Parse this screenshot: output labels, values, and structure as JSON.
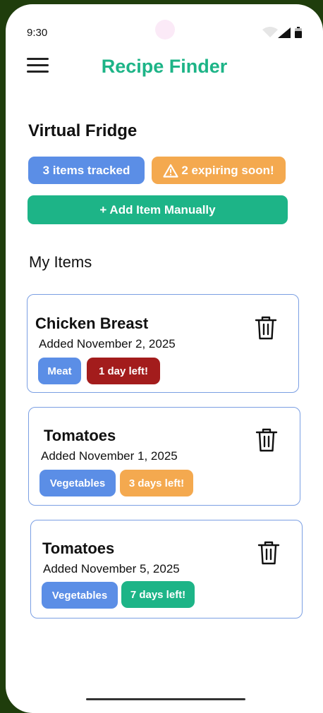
{
  "status_bar": {
    "time": "9:30"
  },
  "header": {
    "title": "Recipe Finder",
    "menu_icon": "hamburger-menu-icon"
  },
  "fridge": {
    "title": "Virtual Fridge",
    "tracked_badge": "3 items tracked",
    "expiring_badge": "2 expiring soon!",
    "add_button": "+ Add Item Manually"
  },
  "items_section": {
    "title": "My Items"
  },
  "items": [
    {
      "name": "Chicken Breast",
      "added": "Added November 2, 2025",
      "category": "Meat",
      "expiry": "1 day left!",
      "expiry_color": "#a31c1c"
    },
    {
      "name": "Tomatoes",
      "added": "Added November 1, 2025",
      "category": "Vegetables",
      "expiry": "3 days left!",
      "expiry_color": "#f4a94f"
    },
    {
      "name": "Tomatoes",
      "added": "Added November 5, 2025",
      "category": "Vegetables",
      "expiry": "7 days left!",
      "expiry_color": "#1db487"
    }
  ],
  "colors": {
    "accent": "#1db487",
    "category_tag": "#5b8ee6",
    "warning": "#f4a94f",
    "card_border": "#7b9fe3"
  }
}
